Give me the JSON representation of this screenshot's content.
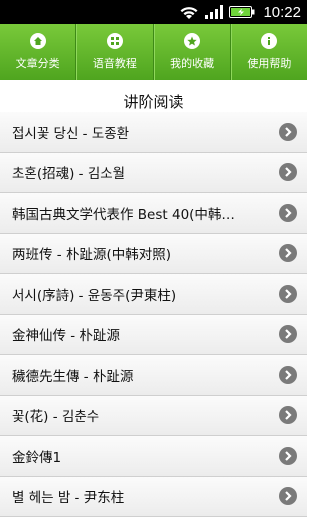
{
  "status_bar": {
    "time": "10:22",
    "icons": [
      "wifi-icon",
      "signal-icon",
      "battery-icon"
    ]
  },
  "tabs": [
    {
      "label": "文章分类",
      "icon": "home-icon"
    },
    {
      "label": "语音教程",
      "icon": "grid-icon"
    },
    {
      "label": "我的收藏",
      "icon": "star-icon"
    },
    {
      "label": "使用帮助",
      "icon": "info-icon"
    }
  ],
  "section": {
    "title": "讲阶阅读"
  },
  "items": [
    {
      "label": "접시꽃 당신 - 도종환"
    },
    {
      "label": "초혼(招魂) - 김소월"
    },
    {
      "label": "韩国古典文学代表作 Best 40(中韩…"
    },
    {
      "label": "两班传 - 朴趾源(中韩对照)"
    },
    {
      "label": "서시(序詩) - 윤동주(尹東柱)"
    },
    {
      "label": "金神仙传 - 朴趾源"
    },
    {
      "label": "穢德先生傳 - 朴趾源"
    },
    {
      "label": "꽃(花) - 김춘수"
    },
    {
      "label": "金鈴傳1"
    },
    {
      "label": "별 헤는 밤 - 尹东柱"
    }
  ],
  "colors": {
    "tab_bar": "#5cb327",
    "chevron": "#7a7a7a"
  }
}
